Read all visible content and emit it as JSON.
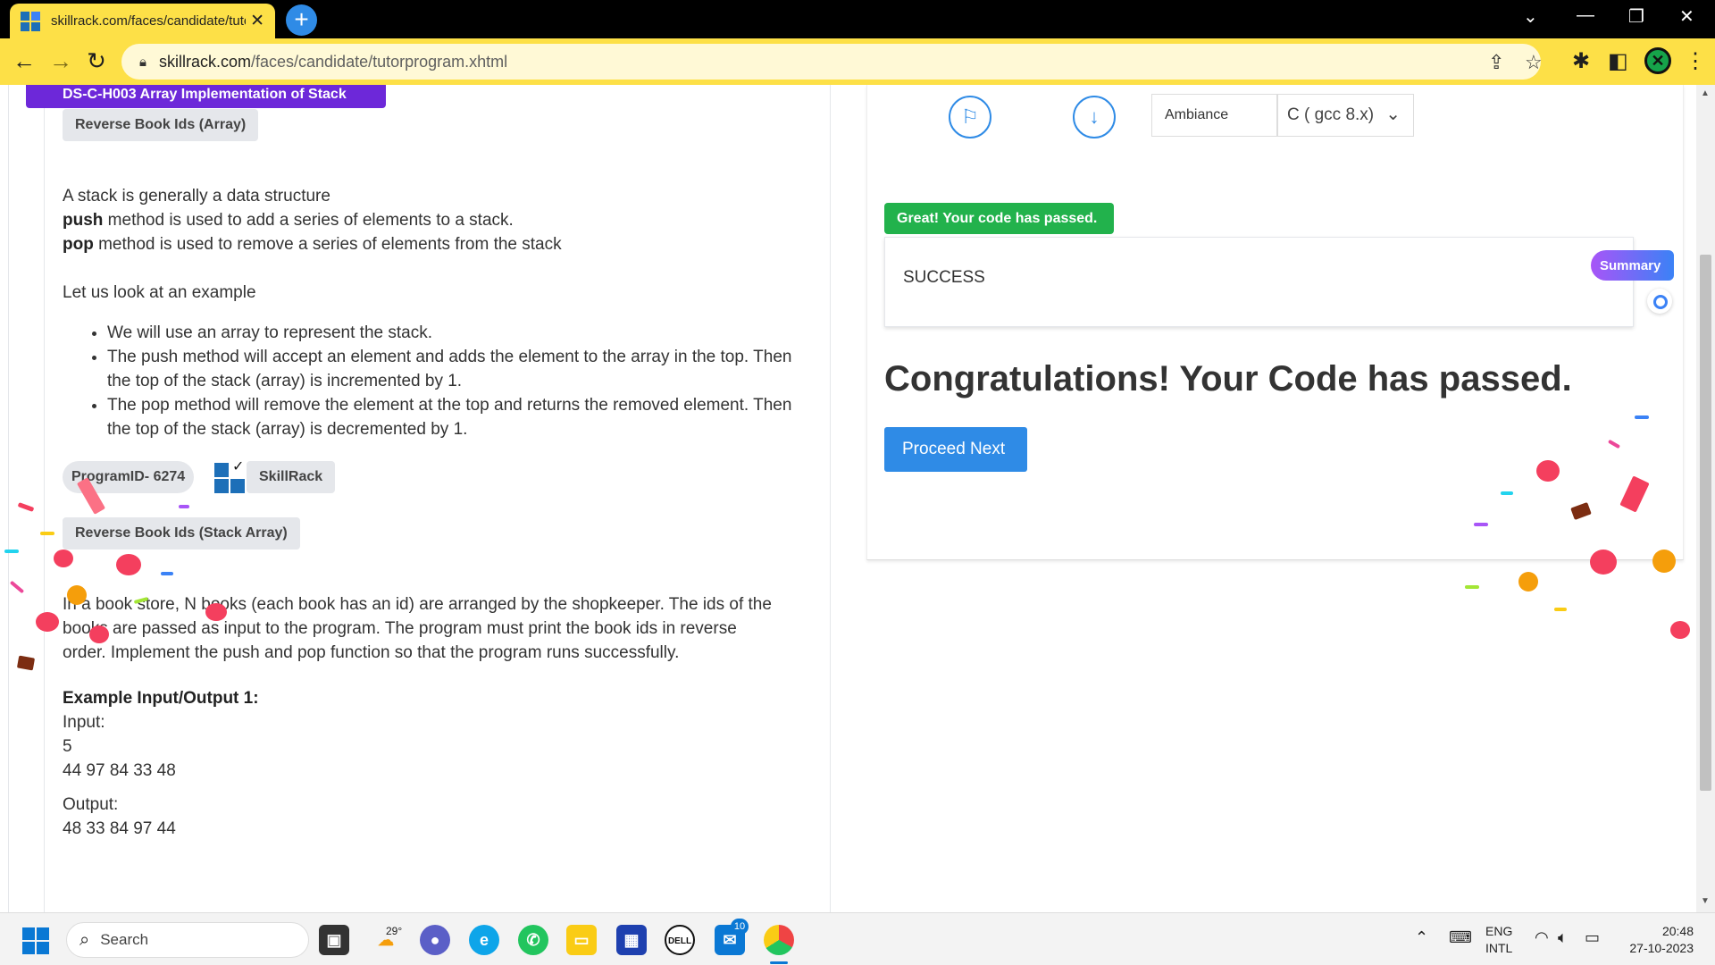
{
  "browser": {
    "tab_title": "skillrack.com/faces/candidate/tutorprogram.xhtml",
    "tab_close": "✕",
    "new_tab": "+",
    "url_host": "skillrack.com",
    "url_path": "/faces/candidate/tutorprogram.xhtml",
    "icons": [
      "back-icon",
      "forward-icon",
      "reload-icon",
      "lock-icon",
      "share-icon",
      "star-icon",
      "extensions-icon",
      "sidepanel-icon",
      "profile-icon",
      "menu-icon"
    ],
    "window_controls": [
      "⌄",
      "—",
      "❐",
      "✕"
    ]
  },
  "left": {
    "ribbon": "DS-C-H003 Array Implementation of Stack",
    "topic_chip": "Reverse Book Ids (Array)",
    "intro_line1": "A stack is generally a data structure",
    "push_word": "push",
    "push_rest": " method is used to add a series of elements to a stack.",
    "pop_word": "pop",
    "pop_rest": " method is used to remove a series of elements from the stack",
    "example_intro": "Let us look at an example",
    "bullets": [
      "We will use an array to represent the stack.",
      "The push method will accept an element and adds the element to the array in the top. Then the top of the stack (array) is incremented by 1.",
      "The pop method will remove the element at the top and returns the removed element. Then the top of the stack (array) is decremented by 1."
    ],
    "program_id": "ProgramID- 6274",
    "brand": "SkillRack",
    "problem_chip": "Reverse Book Ids (Stack Array)",
    "problem_line1": "In a book store, N books (each book has an id) are arranged by the shopkeeper. The ids of the",
    "problem_line2": "books are passed as input to the program. The program must print the book ids in reverse",
    "problem_line3": "order. Implement the push and pop function so that the program runs successfully.",
    "example_heading": "Example Input/Output 1:",
    "input_label": "Input:",
    "input_n": "5",
    "input_values": "44 97 84 33 48",
    "output_label": "Output:",
    "output_values": "48 33 84 97 44"
  },
  "right": {
    "theme_label": "Ambiance",
    "language_label": "C ( gcc 8.x)",
    "pass_badge": "Great! Your code has passed.",
    "result_text": "SUCCESS",
    "congrats": "Congratulations! Your Code has passed.",
    "proceed_label": "Proceed Next",
    "summary_label": "Summary"
  },
  "taskbar": {
    "search_label": "Search",
    "weather_temp": "29°",
    "badge_count": "10",
    "lang_line1": "ENG",
    "lang_line2": "INTL",
    "time": "20:48",
    "date": "27-10-2023"
  },
  "colors": {
    "tab_yellow": "#fde047",
    "ribbon_purple": "#6d28d9",
    "pass_green": "#22b24c",
    "primary_blue": "#2f8be6"
  }
}
